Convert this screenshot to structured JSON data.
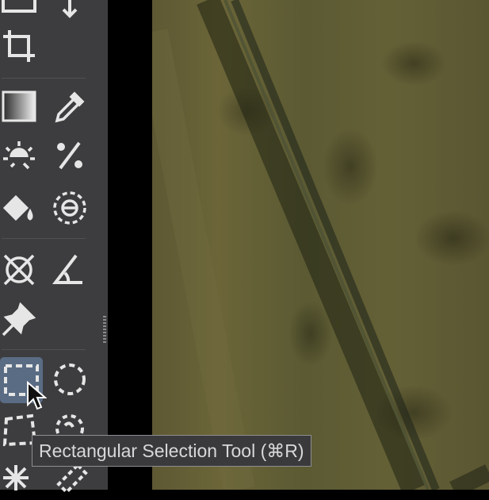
{
  "toolbar": {
    "tools": [
      {
        "name": "move-tool",
        "icon": "move-arrows-icon"
      },
      {
        "name": "crop-tool",
        "icon": "crop-icon"
      },
      {
        "name": "gradient-tool",
        "icon": "gradient-icon"
      },
      {
        "name": "color-picker-tool",
        "icon": "eyedropper-icon"
      },
      {
        "name": "healing-tool",
        "icon": "sun-sparkle-icon"
      },
      {
        "name": "clone-tool",
        "icon": "percent-icon"
      },
      {
        "name": "fill-tool",
        "icon": "paint-bucket-icon"
      },
      {
        "name": "flood-selection-tool",
        "icon": "dashed-target-icon"
      },
      {
        "name": "transform-tool",
        "icon": "crossed-circle-icon"
      },
      {
        "name": "measure-tool",
        "icon": "angle-icon"
      },
      {
        "name": "pin-tool",
        "icon": "pushpin-icon"
      },
      {
        "name": "rectangular-selection-tool",
        "icon": "dashed-rectangle-icon",
        "active": true
      },
      {
        "name": "elliptical-selection-tool",
        "icon": "dashed-circle-icon"
      },
      {
        "name": "freehand-selection-tool",
        "icon": "dashed-freehand-icon"
      },
      {
        "name": "magic-wand-tool",
        "icon": "magic-wand-icon"
      }
    ]
  },
  "tooltip": {
    "text": "Rectangular Selection Tool (⌘R)"
  },
  "colors": {
    "toolbar_bg": "#3d3d3f",
    "active_tool_bg": "#5a6c84",
    "icon_color": "#e6e6e6"
  }
}
